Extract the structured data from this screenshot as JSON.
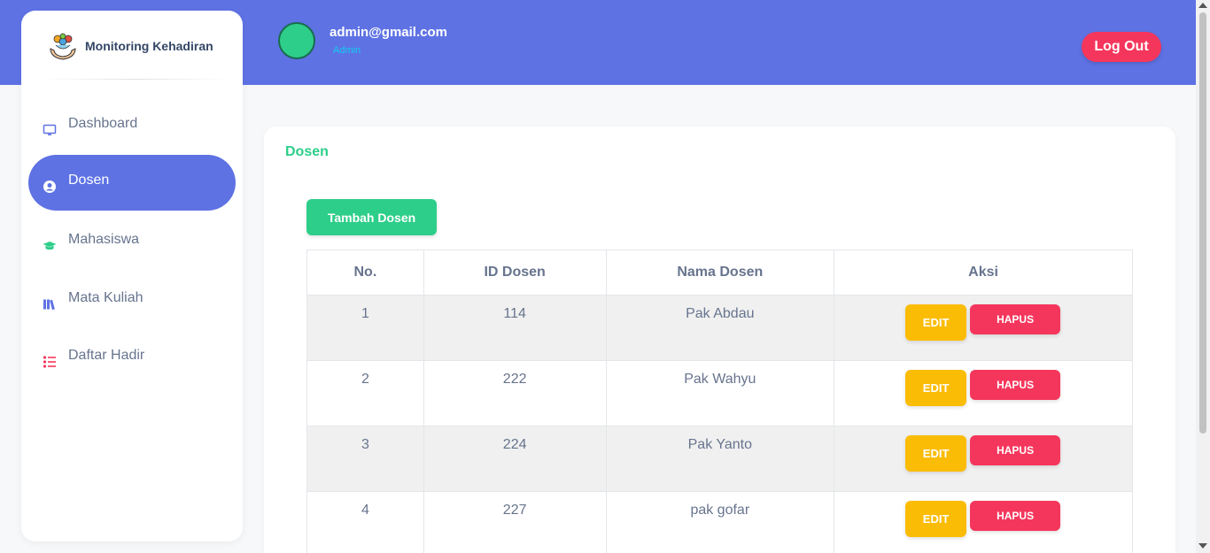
{
  "brand": {
    "name": "Monitoring Kehadiran"
  },
  "user": {
    "email": "admin@gmail.com",
    "role": "Admin"
  },
  "header": {
    "logout_label": "Log Out"
  },
  "sidebar": {
    "items": [
      {
        "label": "Dashboard",
        "icon": "monitor-icon",
        "active": false
      },
      {
        "label": "Dosen",
        "icon": "user-circle-icon",
        "active": true
      },
      {
        "label": "Mahasiswa",
        "icon": "graduation-cap-icon",
        "active": false
      },
      {
        "label": "Mata Kuliah",
        "icon": "books-icon",
        "active": false
      },
      {
        "label": "Daftar Hadir",
        "icon": "list-icon",
        "active": false
      }
    ]
  },
  "main": {
    "title": "Dosen",
    "add_button_label": "Tambah Dosen",
    "table": {
      "headers": [
        "No.",
        "ID Dosen",
        "Nama Dosen",
        "Aksi"
      ],
      "rows": [
        {
          "no": "1",
          "id": "114",
          "nama": "Pak Abdau"
        },
        {
          "no": "2",
          "id": "222",
          "nama": "Pak Wahyu"
        },
        {
          "no": "3",
          "id": "224",
          "nama": "Pak Yanto"
        },
        {
          "no": "4",
          "id": "227",
          "nama": "pak gofar"
        }
      ],
      "edit_label": "EDIT",
      "hapus_label": "HAPUS"
    }
  },
  "colors": {
    "primary": "#5e72e4",
    "success": "#2dce89",
    "warning": "#fbbc05",
    "danger": "#f5365c",
    "info": "#11cdef"
  }
}
